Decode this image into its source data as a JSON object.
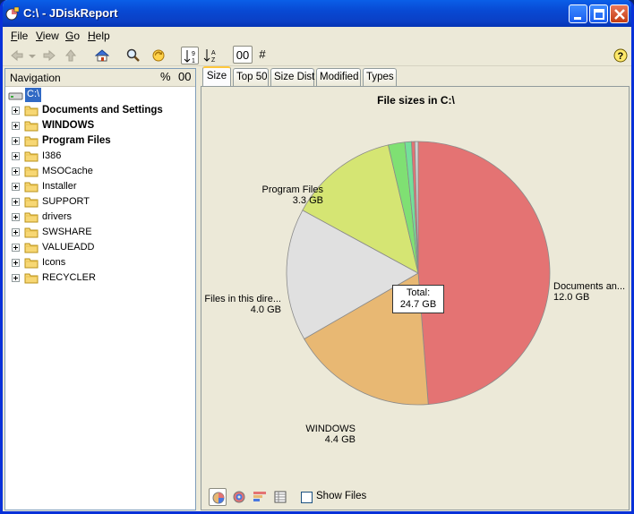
{
  "window": {
    "title": "C:\\ - JDiskReport"
  },
  "menu": [
    "File",
    "View",
    "Go",
    "Help"
  ],
  "toolbar": {
    "sort_digits": "00",
    "hash": "#"
  },
  "navigation": {
    "title": "Navigation",
    "percent_button": "%",
    "digits_button": "00",
    "root": "C:\\",
    "items": [
      {
        "label": "Documents and Settings",
        "bold": true
      },
      {
        "label": "WINDOWS",
        "bold": true
      },
      {
        "label": "Program Files",
        "bold": true
      },
      {
        "label": "I386",
        "bold": false
      },
      {
        "label": "MSOCache",
        "bold": false
      },
      {
        "label": "Installer",
        "bold": false
      },
      {
        "label": "SUPPORT",
        "bold": false
      },
      {
        "label": "drivers",
        "bold": false
      },
      {
        "label": "SWSHARE",
        "bold": false
      },
      {
        "label": "VALUEADD",
        "bold": false
      },
      {
        "label": "Icons",
        "bold": false
      },
      {
        "label": "RECYCLER",
        "bold": false
      }
    ]
  },
  "tabs": [
    "Size",
    "Top 50",
    "Size Dist",
    "Modified",
    "Types"
  ],
  "active_tab": "Size",
  "chart_data": {
    "type": "pie",
    "title": "File sizes in C:\\",
    "total_label": "Total:",
    "total_value": "24.7 GB",
    "slices": [
      {
        "name": "Documents an...",
        "value_gb": 12.0,
        "value_label": "12.0 GB",
        "color": "#e47373"
      },
      {
        "name": "WINDOWS",
        "value_gb": 4.4,
        "value_label": "4.4 GB",
        "color": "#e8b873"
      },
      {
        "name": "Files in this dire...",
        "value_gb": 4.0,
        "value_label": "4.0 GB",
        "color": "#e0e0e0"
      },
      {
        "name": "Program Files",
        "value_gb": 3.3,
        "value_label": "3.3 GB",
        "color": "#d5e573"
      },
      {
        "name": "",
        "value_gb": 0.5,
        "value_label": "",
        "color": "#7fe073"
      },
      {
        "name": "",
        "value_gb": 0.2,
        "value_label": "",
        "color": "#73e09a"
      },
      {
        "name": "",
        "value_gb": 0.1,
        "value_label": "",
        "color": "#e47373"
      },
      {
        "name": "",
        "value_gb": 0.1,
        "value_label": "",
        "color": "#d0d0d0"
      }
    ]
  },
  "bottom": {
    "show_files_label": "Show Files",
    "show_files_checked": false
  }
}
